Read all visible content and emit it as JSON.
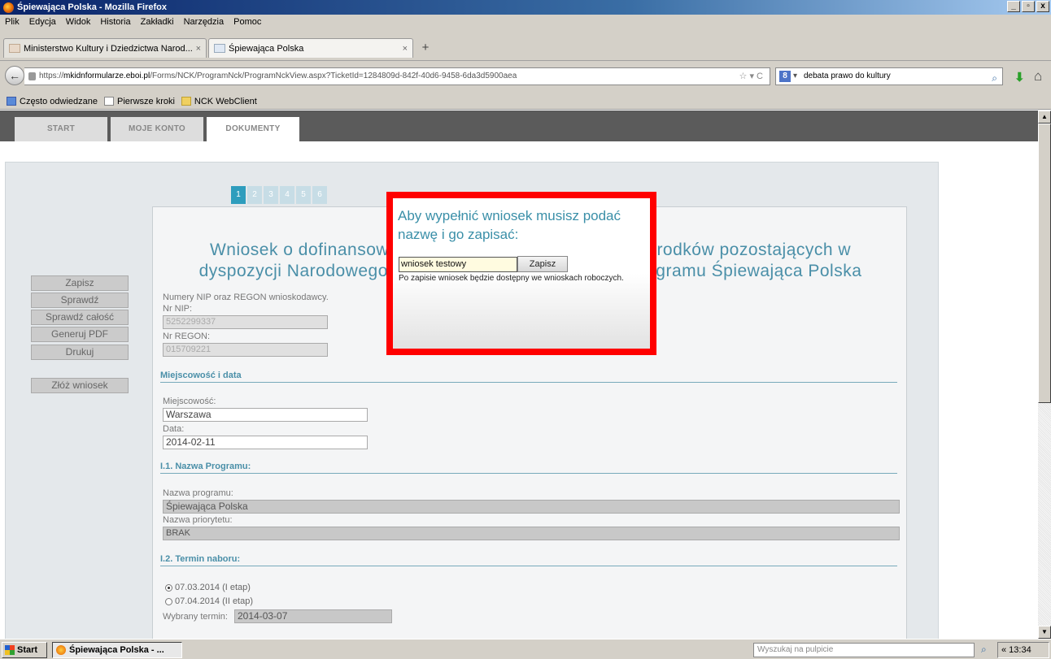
{
  "window": {
    "title": "Śpiewająca Polska - Mozilla Firefox",
    "controls": [
      "_",
      "▫",
      "x"
    ]
  },
  "menu": [
    "Plik",
    "Edycja",
    "Widok",
    "Historia",
    "Zakładki",
    "Narzędzia",
    "Pomoc"
  ],
  "tabs": [
    {
      "label": "Ministerstwo Kultury i Dziedzictwa Narod...",
      "close": "×"
    },
    {
      "label": "Śpiewająca Polska",
      "close": "×"
    }
  ],
  "new_tab": "+",
  "url": {
    "scheme": "https://",
    "host": "mkidnformularze.eboi.pl",
    "path": "/Forms/NCK/ProgramNck/ProgramNckView.aspx?TicketId=1284809d-842f-40d6-9458-6da3d5900aea",
    "icons": "☆ ▾ C"
  },
  "search": {
    "engine": "8",
    "value": "debata prawo do kultury"
  },
  "bookmarks": [
    "Często odwiedzane",
    "Pierwsze kroki",
    "NCK WebClient"
  ],
  "site_nav": [
    "START",
    "MOJE KONTO",
    "DOKUMENTY"
  ],
  "steps": [
    "1",
    "2",
    "3",
    "4",
    "5",
    "6"
  ],
  "form": {
    "title_line1": "Wniosek o dofinansow                                                    rodków pozostających w",
    "title_line2": "dyspozycji Narodowego                                                    gramu Śpiewająca Polska",
    "nip_heading": "Numery NIP oraz REGON wnioskodawcy.",
    "nip_label": "Nr NIP:",
    "nip_value": "5252299337",
    "regon_label": "Nr REGON:",
    "regon_value": "015709221",
    "section_place": "Miejscowość i data",
    "place_label": "Miejscowość:",
    "place_value": "Warszawa",
    "date_label": "Data:",
    "date_value": "2014-02-11",
    "section_program": "I.1. Nazwa Programu:",
    "program_label": "Nazwa programu:",
    "program_value": "Śpiewająca Polska",
    "priority_label": "Nazwa priorytetu:",
    "priority_value": "BRAK",
    "section_term": "I.2. Termin naboru:",
    "term_option1": "07.03.2014 (I etap)",
    "term_option2": "07.04.2014 (II etap)",
    "term_selected_label": "Wybrany termin:",
    "term_selected_value": "2014-03-07"
  },
  "side_buttons": [
    "Zapisz",
    "Sprawdź",
    "Sprawdź całość",
    "Generuj PDF",
    "Drukuj"
  ],
  "submit_button": "Złóż wniosek",
  "modal": {
    "title": "Aby wypełnić wniosek musisz podać nazwę i go zapisać:",
    "input_value": "wniosek testowy",
    "save_button": "Zapisz",
    "note": "Po zapisie wniosek będzie dostępny we wnioskach roboczych."
  },
  "taskbar": {
    "start": "Start",
    "item": "Śpiewająca Polska - ...",
    "search_placeholder": "Wyszukaj na pulpicie",
    "clock": "« 13:34"
  }
}
